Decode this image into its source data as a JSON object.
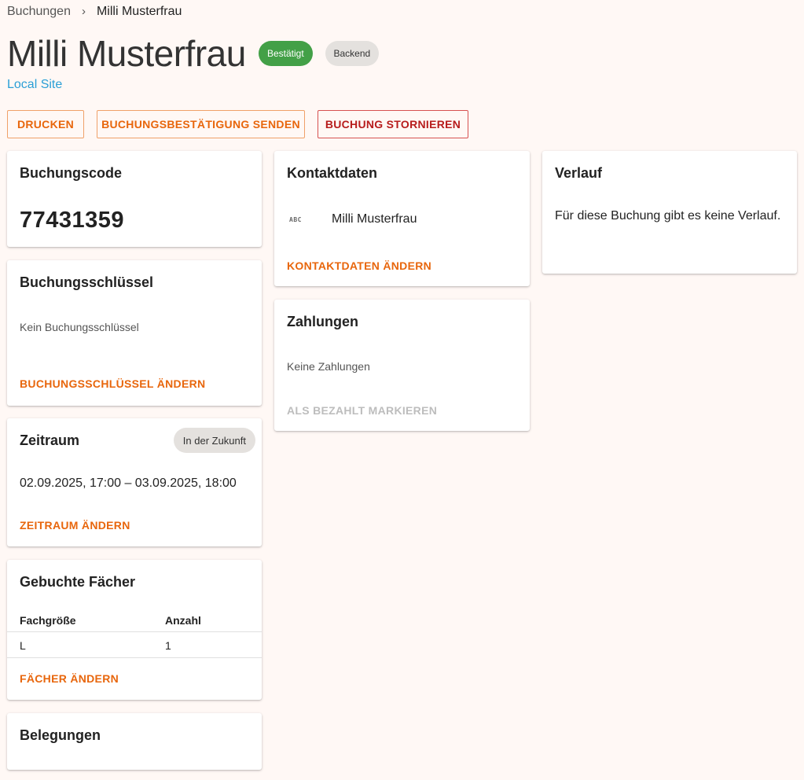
{
  "breadcrumb": {
    "parent": "Buchungen",
    "separator": "›",
    "current": "Milli Musterfrau"
  },
  "header": {
    "title": "Milli Musterfrau",
    "status_chip": "Bestätigt",
    "source_chip": "Backend",
    "site_link": "Local Site"
  },
  "actions": {
    "print": "DRUCKEN",
    "send_confirmation": "BUCHUNGSBESTÄTIGUNG SENDEN",
    "cancel_booking": "BUCHUNG STORNIEREN"
  },
  "booking_code": {
    "title": "Buchungscode",
    "value": "77431359"
  },
  "booking_key": {
    "title": "Buchungsschlüssel",
    "empty_text": "Kein Buchungsschlüssel",
    "action": "BUCHUNGSSCHLÜSSEL ÄNDERN"
  },
  "period": {
    "title": "Zeitraum",
    "chip": "In der Zukunft",
    "range": "02.09.2025, 17:00 – 03.09.2025, 18:00",
    "action": "ZEITRAUM ÄNDERN"
  },
  "compartments": {
    "title": "Gebuchte Fächer",
    "columns": [
      "Fachgröße",
      "Anzahl"
    ],
    "rows": [
      [
        "L",
        "1"
      ]
    ],
    "action": "FÄCHER ÄNDERN"
  },
  "allocations": {
    "title": "Belegungen"
  },
  "contact": {
    "title": "Kontaktdaten",
    "icon": "abc-icon",
    "icon_text": "ABC",
    "name": "Milli Musterfrau",
    "action": "KONTAKTDATEN ÄNDERN"
  },
  "payments": {
    "title": "Zahlungen",
    "empty_text": "Keine Zahlungen",
    "action": "ALS BEZAHLT MARKIEREN"
  },
  "history": {
    "title": "Verlauf",
    "empty_text": "Für diese Buchung gibt es keine Verlauf."
  },
  "colors": {
    "accent": "#e8660c",
    "danger": "#b71c1c",
    "success": "#43a047",
    "link": "#2a9fd6",
    "background": "#fff8f5"
  }
}
